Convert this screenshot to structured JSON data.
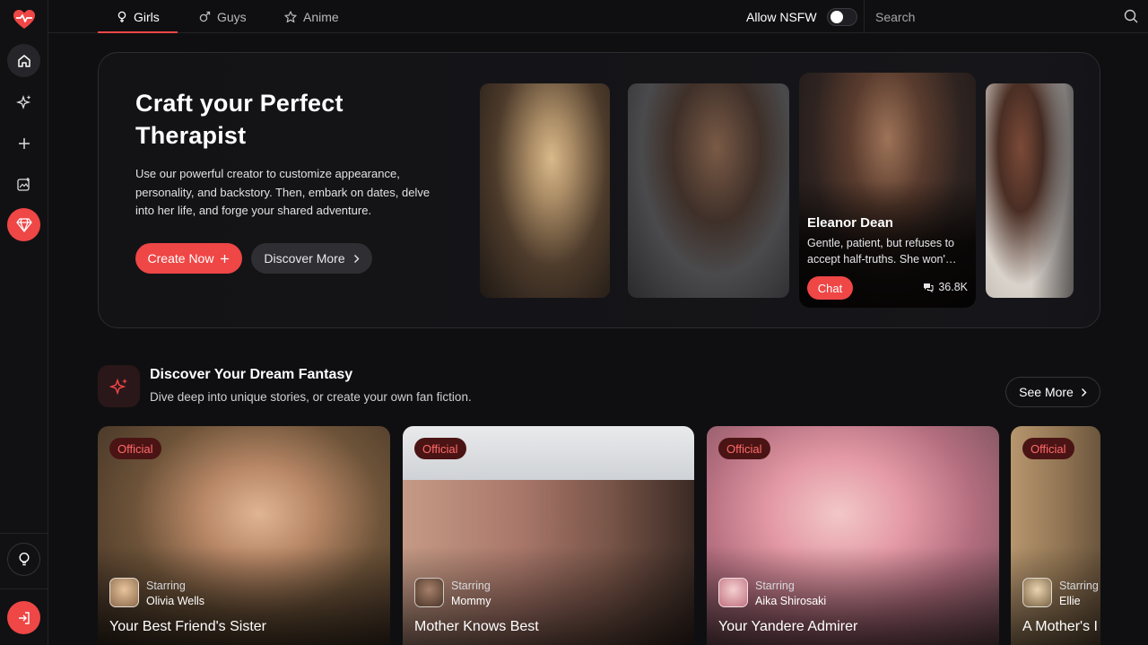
{
  "nav": {
    "tabs": [
      {
        "label": "Girls",
        "icon": "female-icon",
        "active": true
      },
      {
        "label": "Guys",
        "icon": "male-icon"
      },
      {
        "label": "Anime",
        "icon": "star-icon"
      }
    ],
    "nsfw_label": "Allow NSFW",
    "nsfw_enabled": false,
    "search_placeholder": "Search"
  },
  "sidebar": {
    "items": [
      "logo-heart-icon",
      "home-icon",
      "sparkle-icon",
      "plus-icon",
      "image-edit-icon",
      "gem-icon",
      "lightbulb-icon",
      "login-icon"
    ]
  },
  "hero": {
    "title": "Craft your Perfect Therapist",
    "description": "Use our powerful creator to customize appearance, personality, and backstory. Then, embark on dates, delve into her life, and forge your shared adventure.",
    "create_label": "Create Now",
    "discover_label": "Discover More",
    "featured": {
      "name": "Eleanor Dean",
      "description": "Gentle, patient, but refuses to accept half-truths. She won'…",
      "chat_label": "Chat",
      "chat_count": "36.8K"
    }
  },
  "section": {
    "title": "Discover Your Dream Fantasy",
    "subtitle": "Dive deep into unique stories, or create your own fan fiction.",
    "see_more": "See More"
  },
  "stories": [
    {
      "badge": "Official",
      "starring_label": "Starring",
      "character": "Olivia Wells",
      "title": "Your Best Friend's Sister"
    },
    {
      "badge": "Official",
      "starring_label": "Starring",
      "character": "Mommy",
      "title": "Mother Knows Best"
    },
    {
      "badge": "Official",
      "starring_label": "Starring",
      "character": "Aika Shirosaki",
      "title": "Your Yandere Admirer"
    },
    {
      "badge": "Official",
      "starring_label": "Starring",
      "character": "Ellie",
      "title": "A Mother's I"
    }
  ],
  "colors": {
    "accent": "#ef4646",
    "background": "#0f0f11"
  }
}
